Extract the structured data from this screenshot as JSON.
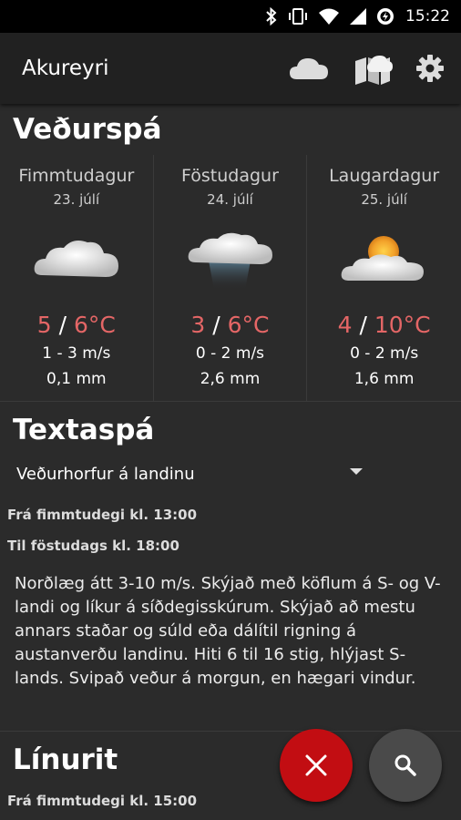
{
  "status_bar": {
    "time": "15:22",
    "icons": [
      "bluetooth-icon",
      "vibrate-icon",
      "wifi-icon",
      "signal-icon",
      "battery-icon"
    ]
  },
  "app_bar": {
    "title": "Akureyri",
    "actions": [
      "cloud-icon",
      "weather-map-icon",
      "settings-gear-icon"
    ]
  },
  "forecast": {
    "title": "Veðurspá",
    "days": [
      {
        "name": "Fimmtudagur",
        "date": "23. júlí",
        "icon": "cloudy-icon",
        "temp_low": "5",
        "sep": " / ",
        "temp_high": "6°C",
        "wind": "1 - 3 m/s",
        "rain": "0,1  mm"
      },
      {
        "name": "Föstudagur",
        "date": "24. júlí",
        "icon": "rain-cloud-icon",
        "temp_low": "3",
        "sep": " / ",
        "temp_high": "6°C",
        "wind": "0 - 2 m/s",
        "rain": "2,6  mm"
      },
      {
        "name": "Laugardagur",
        "date": "25. júlí",
        "icon": "partly-sunny-icon",
        "temp_low": "4",
        "sep": " / ",
        "temp_high": "10°C",
        "wind": "0 - 2 m/s",
        "rain": "1,6  mm"
      }
    ]
  },
  "text_forecast": {
    "title": "Textaspá",
    "region_selected": "Veðurhorfur á landinu",
    "from_label": "Frá fimmtudegi kl. 13:00",
    "to_label": "Til föstudags kl. 18:00",
    "body": "Norðlæg átt 3-10 m/s. Skýjað með köflum á S- og V-landi og líkur á síðdegisskúrum. Skýjað að mestu annars staðar og súld eða dálítil rigning á austanverðu landinu. Hiti 6 til 16 stig, hlýjast S-lands. Svipað veður á morgun, en hægari vindur."
  },
  "chart_section": {
    "title": "Línurit",
    "from_label": "Frá fimmtudegi kl. 15:00"
  },
  "colors": {
    "background": "#2b2b2b",
    "app_bar": "#212121",
    "temperature": "#e46666",
    "fab_close": "#c20d12",
    "fab_search": "#4a4a4a"
  }
}
